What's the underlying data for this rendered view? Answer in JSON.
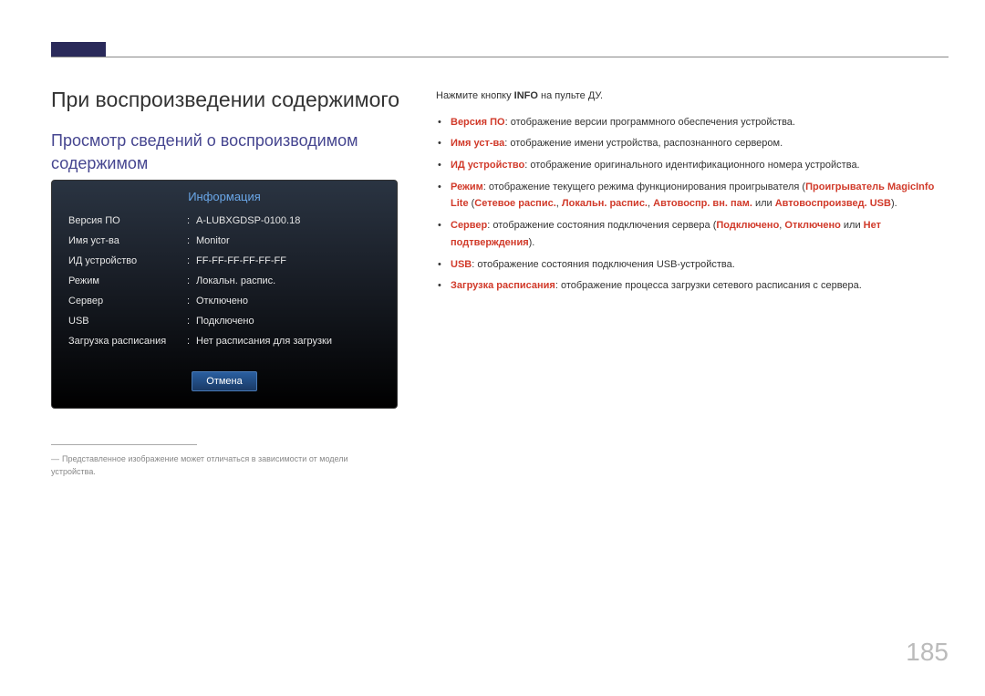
{
  "title": "При воспроизведении содержимого",
  "subtitle": "Просмотр сведений о воспроизводимом содержимом",
  "panel": {
    "title": "Информация",
    "rows": [
      {
        "label": "Версия ПО",
        "value": "A-LUBXGDSP-0100.18"
      },
      {
        "label": "Имя уст-ва",
        "value": "Monitor"
      },
      {
        "label": "ИД устройство",
        "value": "FF-FF-FF-FF-FF-FF"
      },
      {
        "label": "Режим",
        "value": "Локальн. распис."
      },
      {
        "label": "Сервер",
        "value": "Отключено"
      },
      {
        "label": "USB",
        "value": "Подключено"
      },
      {
        "label": "Загрузка расписания",
        "value": "Нет расписания для загрузки"
      }
    ],
    "cancel": "Отмена"
  },
  "disclaimer": "Представленное изображение может отличаться в зависимости от модели устройства.",
  "intro_pre": "Нажмите кнопку ",
  "intro_bold": "INFO",
  "intro_post": " на пульте ДУ.",
  "bullets": {
    "b1_hl": "Версия ПО",
    "b1_txt": ": отображение версии программного обеспечения устройства.",
    "b2_hl": "Имя уст-ва",
    "b2_txt": ": отображение имени устройства, распознанного сервером.",
    "b3_hl": "ИД устройство",
    "b3_txt": ": отображение оригинального идентификационного номера устройства.",
    "b4_hl": "Режим",
    "b4_txt1": ": отображение текущего режима функционирования проигрывателя (",
    "b4_hl2": "Проигрыватель MagicInfo Lite",
    "b4_txt2": " (",
    "b4_hl3": "Сетевое распис.",
    "b4_c1": ", ",
    "b4_hl4": "Локальн. распис.",
    "b4_c2": ", ",
    "b4_hl5": "Автовоспр. вн. пам.",
    "b4_txt3": " или ",
    "b4_hl6": "Автовоспроизвед. USB",
    "b4_txt4": ").",
    "b5_hl": "Сервер",
    "b5_txt1": ": отображение состояния подключения сервера (",
    "b5_hl2": "Подключено",
    "b5_c1": ", ",
    "b5_hl3": "Отключено",
    "b5_txt2": " или ",
    "b5_hl4": "Нет подтверждения",
    "b5_txt3": ").",
    "b6_hl": "USB",
    "b6_txt": ": отображение состояния подключения USB-устройства.",
    "b7_hl": "Загрузка расписания",
    "b7_txt": ": отображение процесса загрузки сетевого расписания с сервера."
  },
  "page": "185"
}
